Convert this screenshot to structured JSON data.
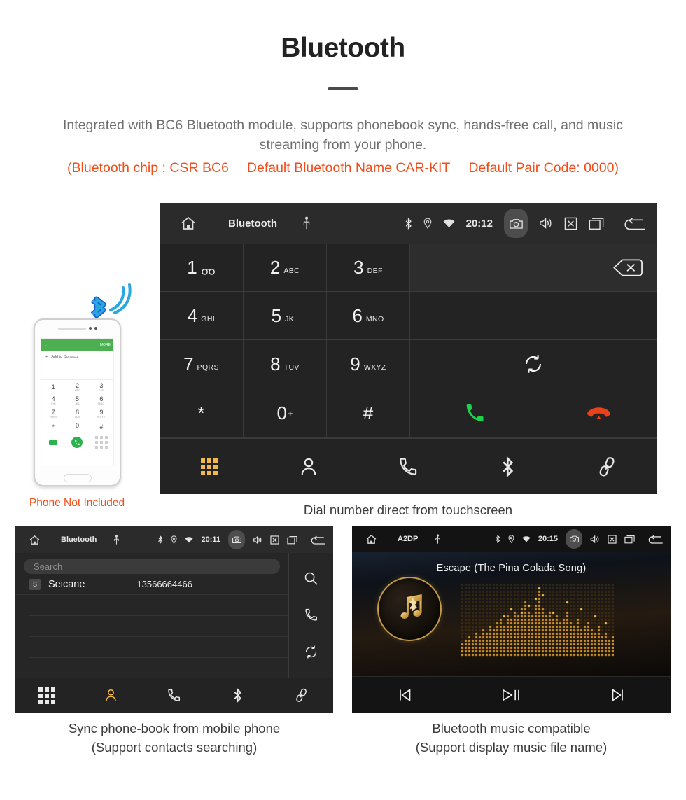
{
  "header": {
    "title": "Bluetooth",
    "subtitle": "Integrated with BC6 Bluetooth module, supports phonebook sync, hands-free call, and music streaming from your phone.",
    "spec_chip": "(Bluetooth chip : CSR BC6",
    "spec_name": "Default Bluetooth Name CAR-KIT",
    "spec_pair": "Default Pair Code: 0000)",
    "accent_color": "#f44c18",
    "subtitle_color": "#6f6f6f"
  },
  "phone_mock": {
    "note": "Phone Not Included",
    "screen": {
      "back_icon": "back-arrow-icon",
      "more_label": "MORE",
      "add_label": "Add to Contacts",
      "keys": [
        {
          "num": "1",
          "sub": ""
        },
        {
          "num": "2",
          "sub": "ABC"
        },
        {
          "num": "3",
          "sub": "DEF"
        },
        {
          "num": "4",
          "sub": "GHI"
        },
        {
          "num": "5",
          "sub": "JKL"
        },
        {
          "num": "6",
          "sub": "MNO"
        },
        {
          "num": "7",
          "sub": "PQRS"
        },
        {
          "num": "8",
          "sub": "TUV"
        },
        {
          "num": "9",
          "sub": "WXYZ"
        },
        {
          "num": "*",
          "sub": ""
        },
        {
          "num": "0",
          "sub": "+"
        },
        {
          "num": "#",
          "sub": ""
        }
      ]
    }
  },
  "dialer": {
    "statusbar": {
      "home_icon": "home-icon",
      "title": "Bluetooth",
      "usb_icon": "usb-icon",
      "bluetooth_icon": "bluetooth-icon",
      "location_icon": "location-pin-icon",
      "wifi_icon": "wifi-icon",
      "time": "20:12",
      "camera_icon": "camera-icon",
      "volume_icon": "volume-icon",
      "close_icon": "close-box-icon",
      "recents_icon": "recent-apps-icon",
      "back_icon": "back-arrow-icon"
    },
    "keys": [
      {
        "num": "1",
        "sub": "",
        "voicemail": true
      },
      {
        "num": "2",
        "sub": "ABC"
      },
      {
        "num": "3",
        "sub": "DEF"
      },
      {
        "num": "4",
        "sub": "GHI"
      },
      {
        "num": "5",
        "sub": "JKL"
      },
      {
        "num": "6",
        "sub": "MNO"
      },
      {
        "num": "7",
        "sub": "PQRS"
      },
      {
        "num": "8",
        "sub": "TUV"
      },
      {
        "num": "9",
        "sub": "WXYZ"
      },
      {
        "num": "*",
        "sub": ""
      },
      {
        "num": "0",
        "sub": "+"
      },
      {
        "num": "#",
        "sub": ""
      }
    ],
    "number_display_value": "",
    "backspace_icon": "backspace-icon",
    "sync_icon": "sync-icon",
    "call_icon": "call-answer-icon",
    "hangup_icon": "call-end-icon",
    "call_color": "#1fd14b",
    "hangup_color": "#e8411c",
    "tabs": [
      {
        "icon": "keypad-icon",
        "active": true
      },
      {
        "icon": "contacts-icon",
        "active": false
      },
      {
        "icon": "call-log-icon",
        "active": false
      },
      {
        "icon": "bluetooth-icon",
        "active": false
      },
      {
        "icon": "link-pair-icon",
        "active": false
      }
    ],
    "active_tab_color": "#f2b84b",
    "caption": "Dial number direct from touchscreen"
  },
  "phonebook": {
    "statusbar": {
      "home_icon": "home-icon",
      "title": "Bluetooth",
      "usb_icon": "usb-icon",
      "time": "20:11"
    },
    "search_placeholder": "Search",
    "search_value": "",
    "contacts": [
      {
        "initial": "S",
        "name": "Seicane",
        "number": "13566664466"
      }
    ],
    "side_actions": [
      {
        "icon": "search-icon"
      },
      {
        "icon": "call-log-icon"
      },
      {
        "icon": "sync-icon"
      }
    ],
    "tabs": [
      {
        "icon": "keypad-icon",
        "active": false
      },
      {
        "icon": "contacts-icon",
        "active": true
      },
      {
        "icon": "call-log-icon",
        "active": false
      },
      {
        "icon": "bluetooth-icon",
        "active": false
      },
      {
        "icon": "link-pair-icon",
        "active": false
      }
    ],
    "caption_line1": "Sync phone-book from mobile phone",
    "caption_line2": "(Support contacts searching)"
  },
  "music": {
    "statusbar": {
      "home_icon": "home-icon",
      "title": "A2DP",
      "usb_icon": "usb-icon",
      "time": "20:15"
    },
    "track_title": "Escape (The Pina Colada Song)",
    "album_icon": "music-note-bluetooth-icon",
    "controls": [
      {
        "icon": "previous-track-icon"
      },
      {
        "icon": "play-pause-icon"
      },
      {
        "icon": "next-track-icon"
      }
    ],
    "caption_line1": "Bluetooth music compatible",
    "caption_line2": "(Support display music file name)"
  }
}
